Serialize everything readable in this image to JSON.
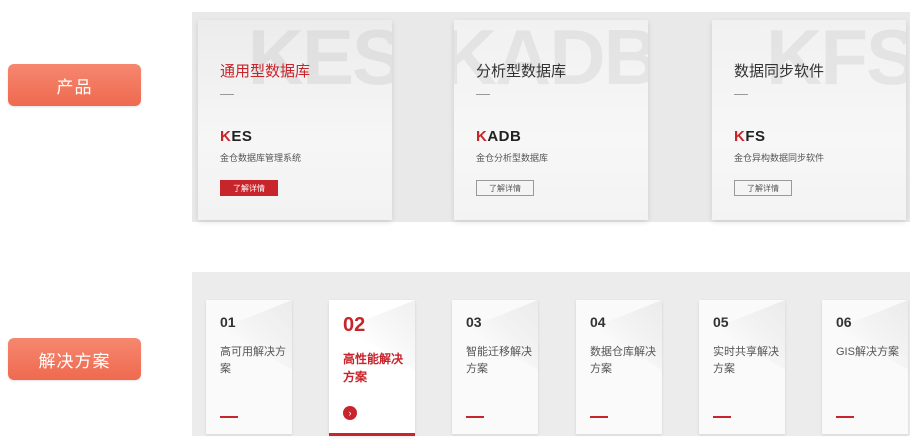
{
  "sidebar": {
    "products_label": "产品",
    "solutions_label": "解决方案"
  },
  "products": [
    {
      "title": "通用型数据库",
      "watermark": "KES",
      "logo_mark": "K",
      "logo_text": "ES",
      "subtitle": "金仓数据库管理系统",
      "button": "了解详情",
      "active": true
    },
    {
      "title": "分析型数据库",
      "watermark": "KADB",
      "logo_mark": "K",
      "logo_text": "ADB",
      "subtitle": "金仓分析型数据库",
      "button": "了解详情",
      "active": false
    },
    {
      "title": "数据同步软件",
      "watermark": "KFS",
      "logo_mark": "K",
      "logo_text": "FS",
      "subtitle": "金仓异构数据同步软件",
      "button": "了解详情",
      "active": false
    }
  ],
  "solutions": [
    {
      "num": "01",
      "title": "高可用解决方案",
      "active": false
    },
    {
      "num": "02",
      "title": "高性能解决方案",
      "active": true,
      "arrow": "›"
    },
    {
      "num": "03",
      "title": "智能迁移解决方案",
      "active": false
    },
    {
      "num": "04",
      "title": "数据仓库解决方案",
      "active": false
    },
    {
      "num": "05",
      "title": "实时共享解决方案",
      "active": false
    },
    {
      "num": "06",
      "title": "GIS解决方案",
      "active": false
    }
  ],
  "colors": {
    "accent": "#c8242b",
    "side_button": "#ee6a4f"
  }
}
